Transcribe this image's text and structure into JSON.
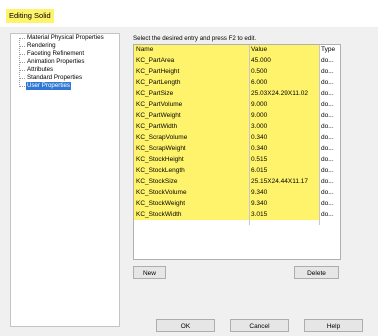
{
  "window": {
    "title": "Editing Solid"
  },
  "tree": {
    "items": [
      "Material Physical Properties",
      "Rendering",
      "Faceting Refinement",
      "Animation Properties",
      "Attributes",
      "Standard Properties",
      "User Properties"
    ],
    "selected": "User Properties"
  },
  "instruction": "Select the desired entry and press F2 to edit.",
  "table": {
    "columns": [
      "Name",
      "Value",
      "Type"
    ],
    "rows": [
      {
        "name": "KC_PartArea",
        "value": "45.000",
        "type": "do..."
      },
      {
        "name": "KC_PartHeight",
        "value": "0.500",
        "type": "do..."
      },
      {
        "name": "KC_PartLength",
        "value": "6.000",
        "type": "do..."
      },
      {
        "name": "KC_PartSize",
        "value": "25.03X24.29X11.02",
        "type": "do..."
      },
      {
        "name": "KC_PartVolume",
        "value": "9.000",
        "type": "do..."
      },
      {
        "name": "KC_PartWeight",
        "value": "9.000",
        "type": "do..."
      },
      {
        "name": "KC_PartWidth",
        "value": "3.000",
        "type": "do..."
      },
      {
        "name": "KC_ScrapVolume",
        "value": "0.340",
        "type": "do..."
      },
      {
        "name": "KC_ScrapWeight",
        "value": "0.340",
        "type": "do..."
      },
      {
        "name": "KC_StockHeight",
        "value": "0.515",
        "type": "do..."
      },
      {
        "name": "KC_StockLength",
        "value": "6.015",
        "type": "do..."
      },
      {
        "name": "KC_StockSize",
        "value": "25.15X24.44X11.17",
        "type": "do..."
      },
      {
        "name": "KC_StockVolume",
        "value": "9.340",
        "type": "do..."
      },
      {
        "name": "KC_StockWeight",
        "value": "9.340",
        "type": "do..."
      },
      {
        "name": "KC_StockWidth",
        "value": "3.015",
        "type": "do..."
      }
    ]
  },
  "buttons": {
    "new": "New",
    "delete": "Delete",
    "ok": "OK",
    "cancel": "Cancel",
    "help": "Help"
  },
  "colors": {
    "highlight": "#fff36b",
    "selection": "#3078d4"
  }
}
